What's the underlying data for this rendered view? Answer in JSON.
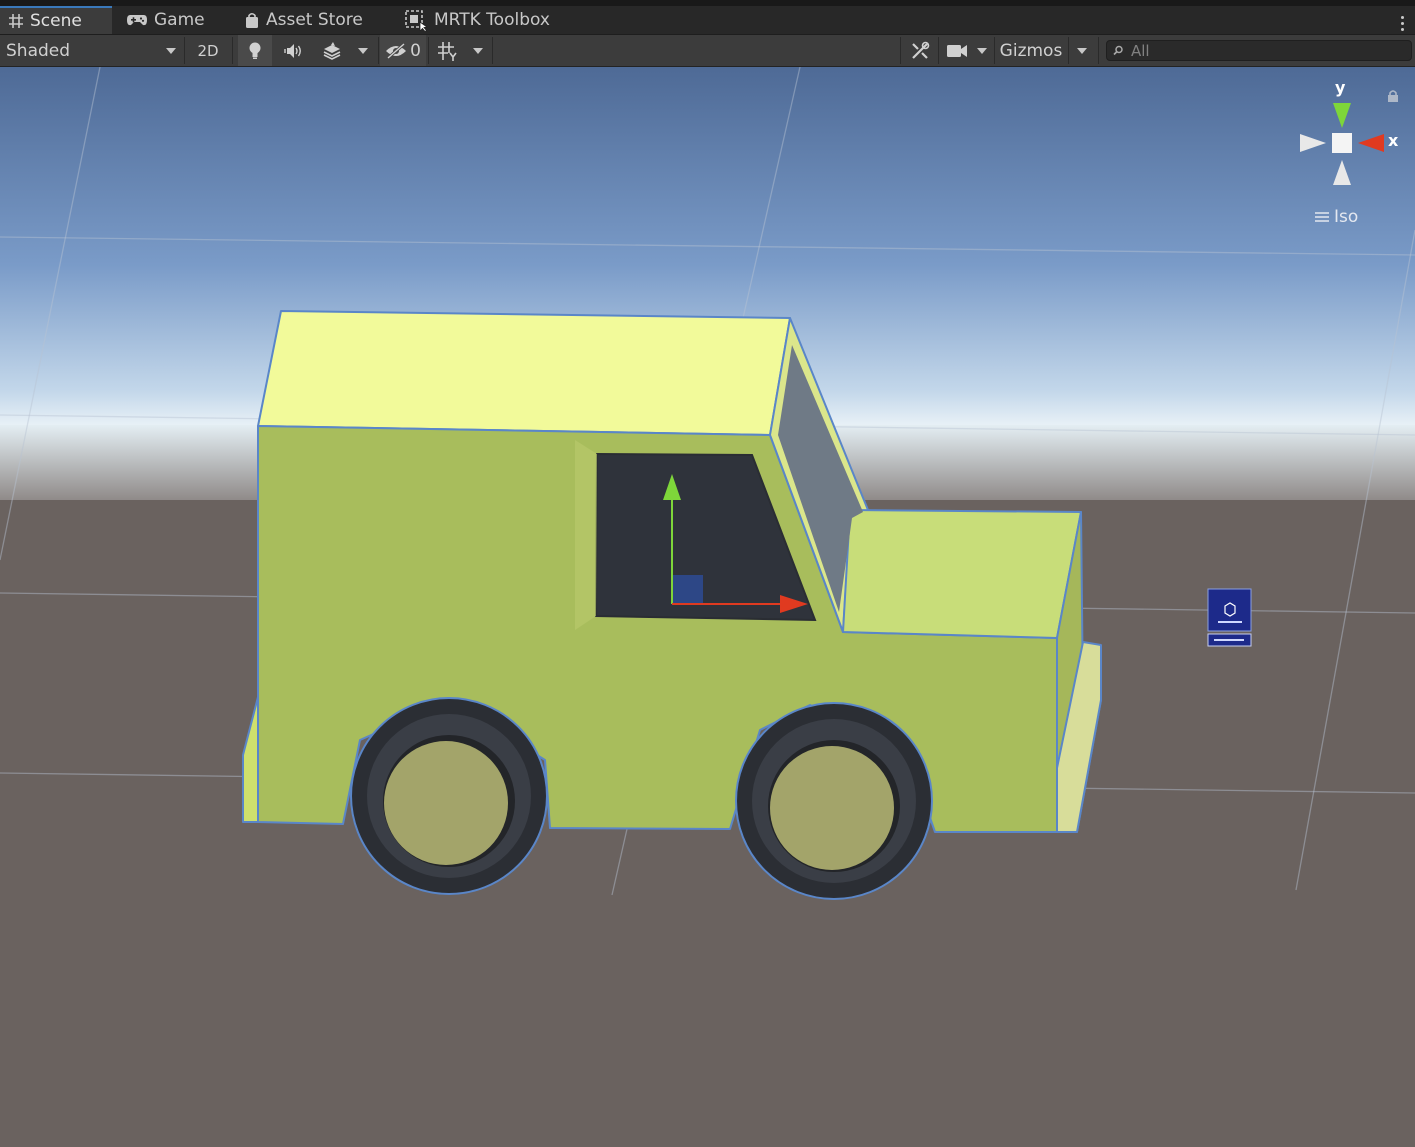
{
  "tabs": [
    {
      "label": "Scene",
      "icon": "grid-hash-icon",
      "active": true
    },
    {
      "label": "Game",
      "icon": "gamepad-icon",
      "active": false
    },
    {
      "label": "Asset Store",
      "icon": "shopping-bag-icon",
      "active": false
    },
    {
      "label": "MRTK Toolbox",
      "icon": "toolbox-icon",
      "active": false
    }
  ],
  "toolbar": {
    "draw_mode": "Shaded",
    "mode_2d": "2D",
    "hidden_count": "0",
    "gizmos_label": "Gizmos",
    "search_placeholder": "All"
  },
  "orientation_gizmo": {
    "y_label": "y",
    "x_label": "x",
    "projection_label": "Iso"
  },
  "colors": {
    "accent": "#3a79bb",
    "vehicle_body": "#a8bd5c",
    "vehicle_top": "#f2fa9a",
    "tire": "#2b2e34",
    "sky_top": "#4e6a96",
    "ground": "#6a625f",
    "axis_x": "#e03a20",
    "axis_y": "#7ed63a"
  }
}
